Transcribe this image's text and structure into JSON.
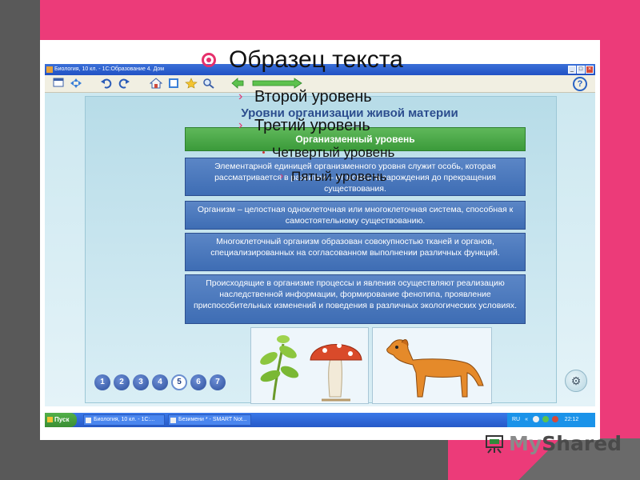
{
  "window": {
    "title": "Биология, 10 кл. - 1С:Образование 4. Дом",
    "controls": [
      "_",
      "□",
      "×"
    ]
  },
  "toolbar": {
    "icons": [
      "window-icon",
      "crosshair-icon",
      "undo-icon",
      "redo-icon",
      "home-icon",
      "book-icon",
      "star-icon",
      "search-icon",
      "back-arrow-icon",
      "forward-arrow-icon"
    ],
    "help": "?"
  },
  "lesson": {
    "heading": "Уровни организации живой материи",
    "level_title": "Организменный уровень",
    "boxes": [
      "Элементарной единицей организменного уровня служит особь, которая рассматривается в развитии – от момента зарождения до прекращения существования.",
      "Организм – целостная одноклеточная или многоклеточная система, способная к самостоятельному существованию.",
      "Многоклеточный организм образован совокупностью тканей и органов, специализированных на согласованном выполнении различных функций.",
      "Происходящие в организме процессы и явления осуществляют реализацию наследственной информации, формирование фенотипа, проявление приспособительных изменений и поведения в различных экологических условиях."
    ],
    "pager": [
      "1",
      "2",
      "3",
      "4",
      "5",
      "6",
      "7"
    ],
    "pager_active": "5"
  },
  "taskbar": {
    "start": "Пуск",
    "items": [
      "Биология, 10 кл. - 1С:...",
      "Безимени * - SMART Not..."
    ],
    "lang": "RU",
    "tray_arrows": "«",
    "clock": "22:12"
  },
  "slide": {
    "title": "Образец текста",
    "level2": "Второй уровень",
    "level3": "Третий уровень",
    "level4": "Четвертый уровень",
    "level5": "Пятый уровень",
    "chevron": "›"
  },
  "logo": {
    "my": "My",
    "shared": "Shared"
  },
  "colors": {
    "slide_pink": "#ec3b79",
    "slide_dark": "#595959",
    "green_bar": "#4aa845",
    "blue_box": "#4c78be",
    "window_title": "#2152c4"
  }
}
